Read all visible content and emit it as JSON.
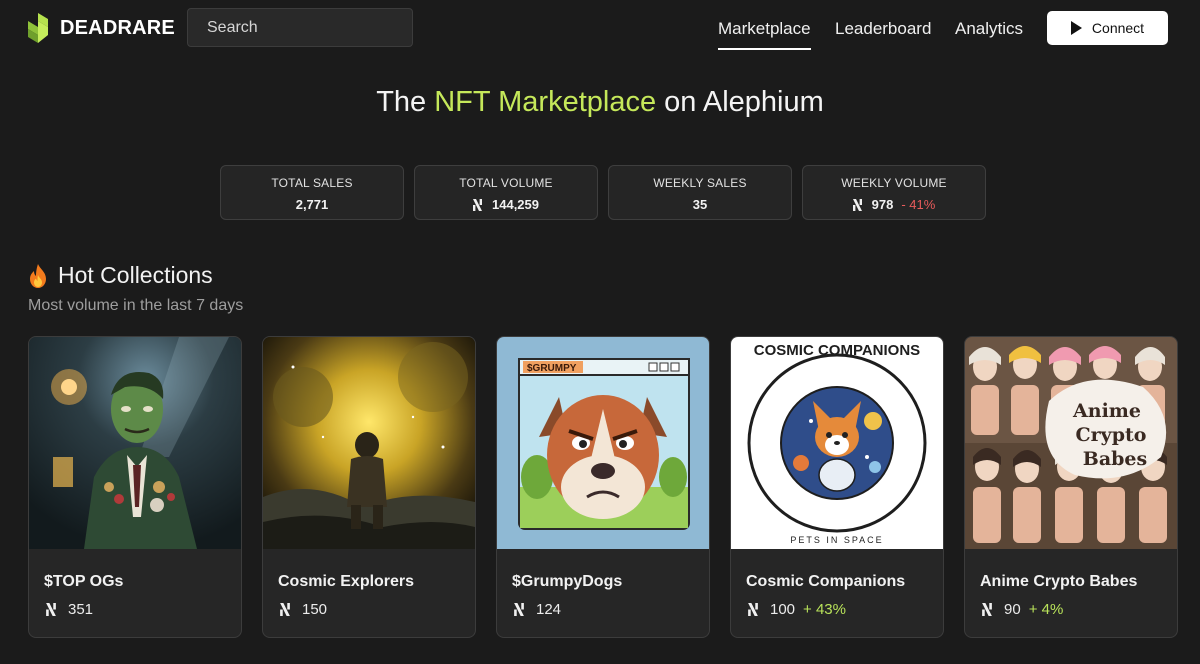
{
  "header": {
    "brand": "DEADRARE",
    "search_placeholder": "Search",
    "nav": [
      {
        "label": "Marketplace",
        "active": true
      },
      {
        "label": "Leaderboard",
        "active": false
      },
      {
        "label": "Analytics",
        "active": false
      }
    ],
    "connect_label": "Connect",
    "logo_color": "#b6e24e"
  },
  "hero": {
    "prefix": "The",
    "accent": "NFT Marketplace",
    "suffix": "on Alephium",
    "accent_color": "#c5e85a"
  },
  "stats": [
    {
      "label": "TOTAL SALES",
      "value": "2,771",
      "currency_icon": false,
      "change": ""
    },
    {
      "label": "TOTAL VOLUME",
      "value": "144,259",
      "currency_icon": true,
      "change": ""
    },
    {
      "label": "WEEKLY SALES",
      "value": "35",
      "currency_icon": false,
      "change": ""
    },
    {
      "label": "WEEKLY VOLUME",
      "value": "978",
      "currency_icon": true,
      "change": "- 41%"
    }
  ],
  "hot_collections": {
    "title": "Hot Collections",
    "icon": "fire-icon",
    "subtitle": "Most volume in the last 7 days"
  },
  "collections": [
    {
      "name": "$TOP OGs",
      "volume": "351",
      "change": ""
    },
    {
      "name": "Cosmic Explorers",
      "volume": "150",
      "change": ""
    },
    {
      "name": "$GrumpyDogs",
      "volume": "124",
      "change": ""
    },
    {
      "name": "Cosmic Companions",
      "volume": "100",
      "change": "+ 43%"
    },
    {
      "name": "Anime Crypto Babes",
      "volume": "90",
      "change": "+ 4%"
    }
  ],
  "artwork_text": {
    "grumpy_banner": "$GRUMPY",
    "companions_ring": "COSMIC COMPANIONS",
    "companions_sub": "PETS IN SPACE",
    "anime_badge": [
      "Anime",
      "Crypto",
      "Babes"
    ]
  },
  "colors": {
    "positive": "#b9e35a",
    "negative": "#e85b5b",
    "background": "#1b1b1b",
    "card": "#262626"
  }
}
